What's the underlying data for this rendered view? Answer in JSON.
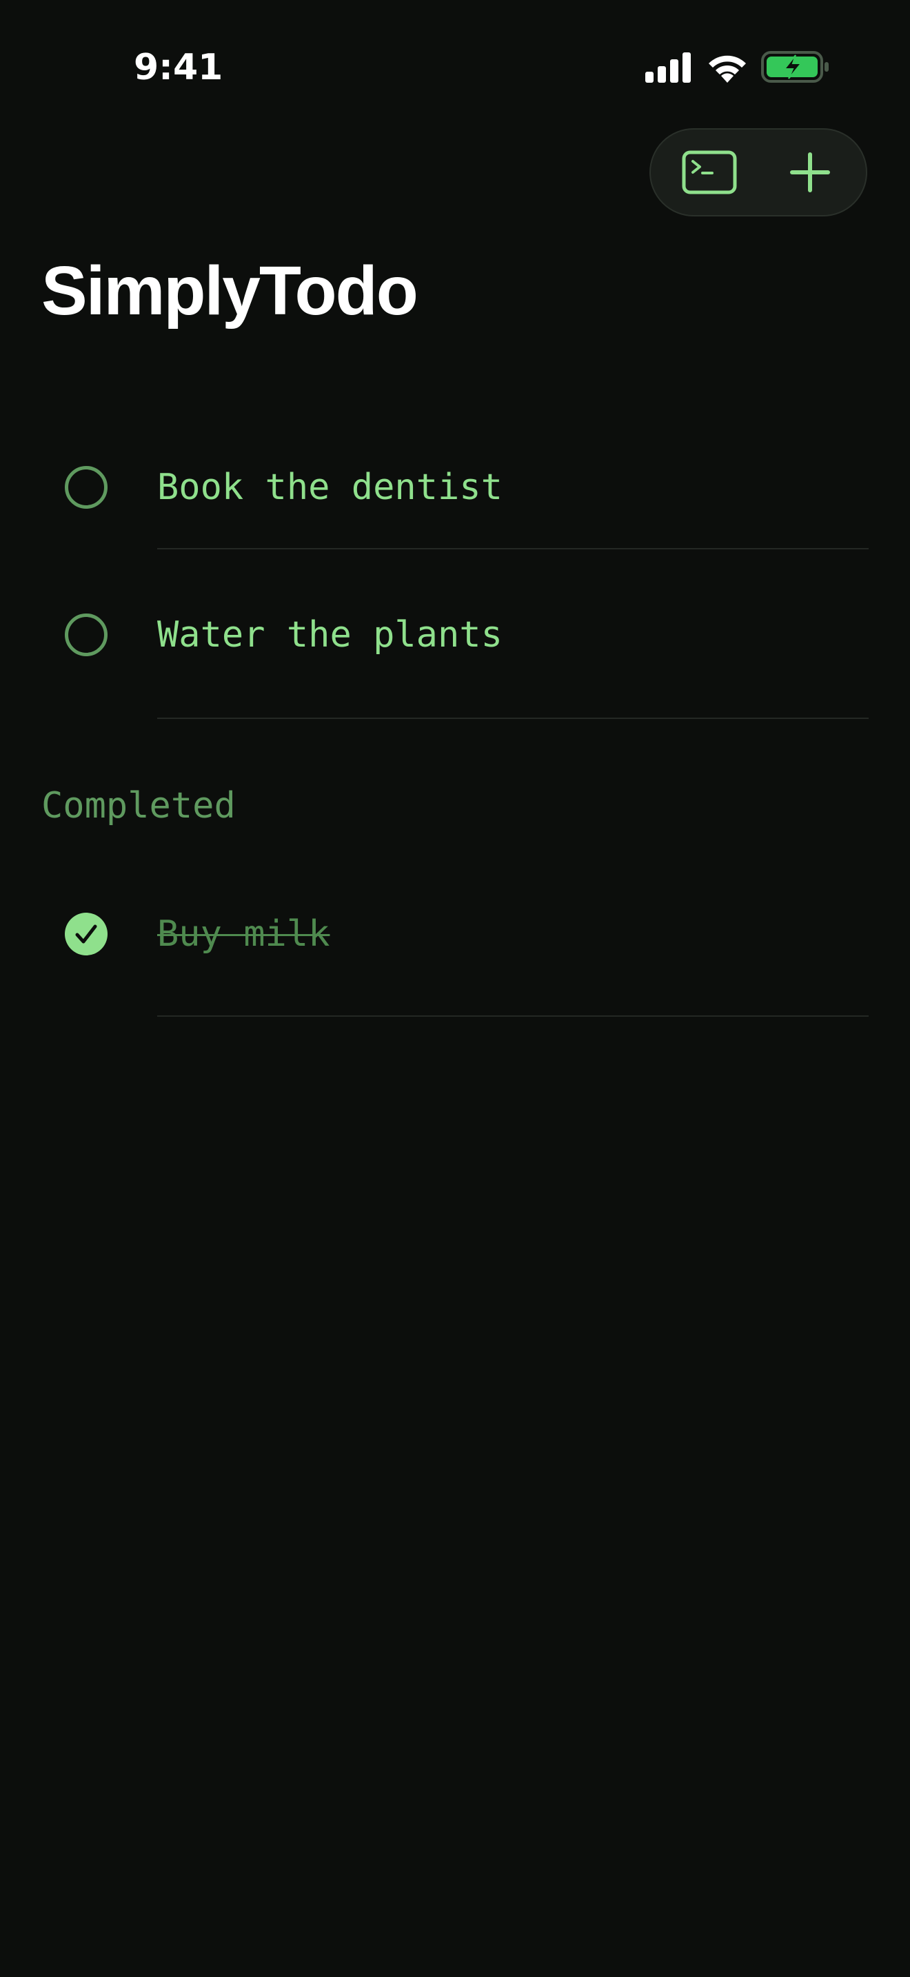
{
  "status_bar": {
    "time": "9:41",
    "icons": [
      "cellular-signal-icon",
      "wifi-icon",
      "battery-charging-icon"
    ]
  },
  "toolbar": {
    "buttons": [
      {
        "icon": "terminal-icon"
      },
      {
        "icon": "plus-icon"
      }
    ]
  },
  "page": {
    "title": "SimplyTodo"
  },
  "todos": {
    "active": [
      {
        "text": "Book the dentist",
        "completed": false
      },
      {
        "text": "Water the plants",
        "completed": false
      }
    ],
    "completed_header": "Completed",
    "completed": [
      {
        "text": "Buy milk",
        "completed": true
      }
    ]
  },
  "colors": {
    "background": "#0c0e0c",
    "accent": "#8fe08c",
    "accent_dim": "#5f9a5f",
    "completed_text": "#4f8a4f",
    "divider": "#242824",
    "battery_fill": "#34c759"
  }
}
